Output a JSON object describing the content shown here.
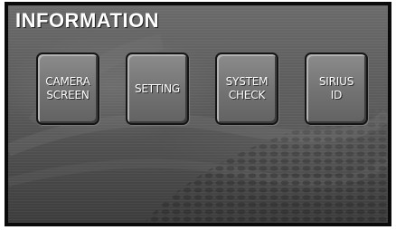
{
  "screen": {
    "title": "INFORMATION"
  },
  "menu": {
    "buttons": [
      {
        "label": "CAMERA\nSCREEN"
      },
      {
        "label": "SETTING"
      },
      {
        "label": "SYSTEM\nCHECK"
      },
      {
        "label": "SIRIUS\nID"
      }
    ]
  },
  "colors": {
    "text": "#ffffff",
    "border": "#0a0a0a",
    "button_face": "#727272",
    "background": "#555555"
  }
}
